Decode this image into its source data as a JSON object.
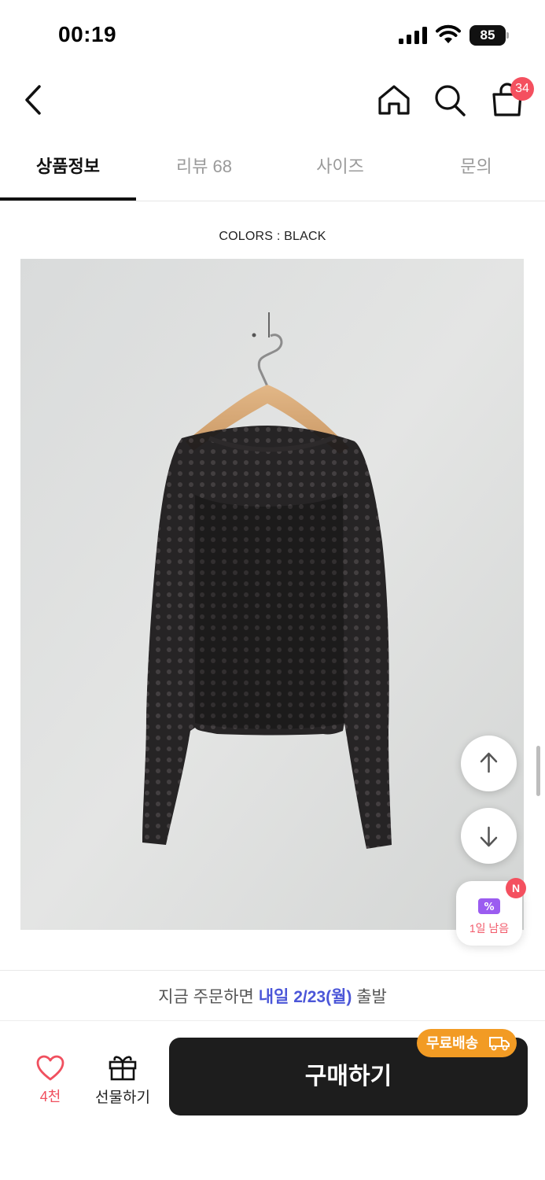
{
  "status_bar": {
    "time": "00:19",
    "battery": "85"
  },
  "header": {
    "cart_badge": "34"
  },
  "tabs": [
    {
      "label": "상품정보",
      "active": true
    },
    {
      "label": "리뷰 68",
      "active": false
    },
    {
      "label": "사이즈",
      "active": false
    },
    {
      "label": "문의",
      "active": false
    }
  ],
  "content": {
    "colors_caption": "COLORS : BLACK"
  },
  "floating": {
    "coupon_label": "1일 남음",
    "coupon_badge": "N"
  },
  "delivery": {
    "prefix": "지금 주문하면",
    "highlight": "내일 2/23(월)",
    "suffix": "출발"
  },
  "bottom_bar": {
    "like_count": "4천",
    "gift_label": "선물하기",
    "buy_label": "구매하기",
    "free_shipping_badge": "무료배송"
  },
  "colors": {
    "accent_red": "#f4505f",
    "delivery_blue": "#4b56d8",
    "free_ship_orange": "#f29b24",
    "buy_button": "#1d1d1d"
  }
}
